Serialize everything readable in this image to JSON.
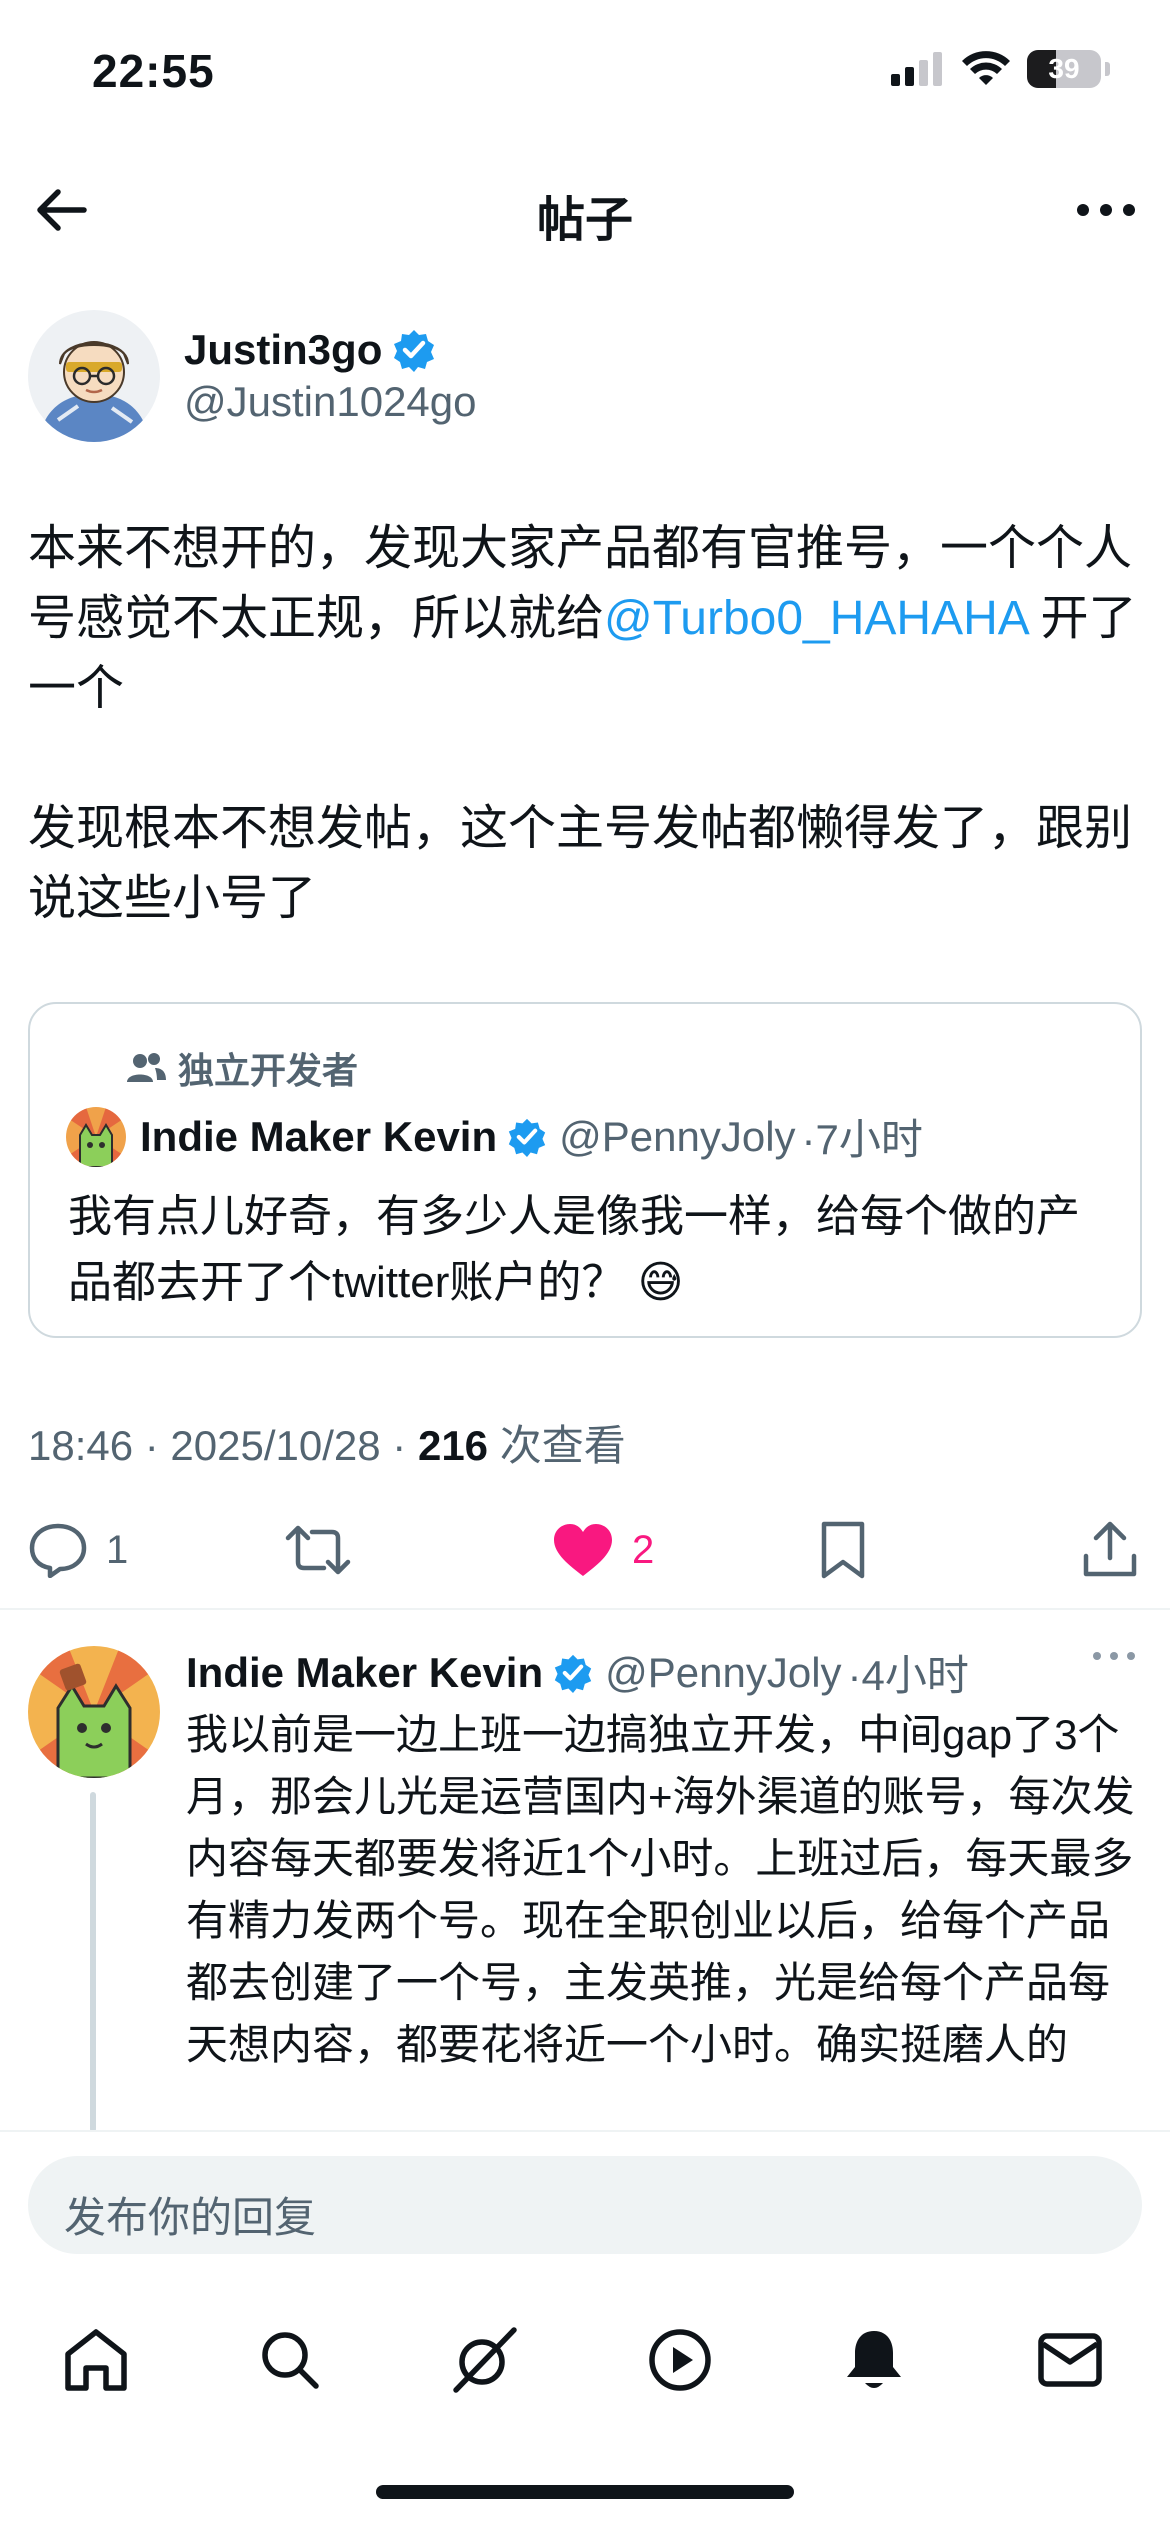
{
  "status_bar": {
    "time": "22:55",
    "battery": "39",
    "battery_level": 0.39
  },
  "nav": {
    "title": "帖子"
  },
  "post": {
    "author": {
      "display_name": "Justin3go",
      "handle": "@Justin1024go",
      "verified": true
    },
    "paragraph1_pre": "本来不想开的，发现大家产品都有官推号，一个个人号感觉不太正规，所以就给",
    "mention": "@Turbo0_HAHAHA",
    "paragraph1_post": " 开了一个",
    "paragraph2": "发现根本不想发帖，这个主号发帖都懒得发了，跟别说这些小号了",
    "timestamp": "18:46 · 2025/10/28 · ",
    "views_count": "216",
    "views_label": " 次查看",
    "stats": {
      "replies": "1",
      "likes": "2"
    }
  },
  "quote": {
    "community": "独立开发者",
    "author": {
      "display_name": "Indie Maker Kevin",
      "handle": "@PennyJoly",
      "time": "·7小时",
      "verified": true
    },
    "text": "我有点儿好奇，有多少人是像我一样，给每个做的产品都去开了个twitter账户的？ 😅"
  },
  "reply": {
    "author": {
      "display_name": "Indie Maker Kevin",
      "handle": "@PennyJoly",
      "time": "·4小时",
      "verified": true
    },
    "text": "我以前是一边上班一边搞独立开发，中间gap了3个月，那会儿光是运营国内+海外渠道的账号，每次发内容每天都要发将近1个小时。上班过后，每天最多有精力发两个号。现在全职创业以后，给每个产品都去创建了一个号，主发英推，光是给每个产品每天想内容，都要花将近一个小时。确实挺磨人的"
  },
  "composer": {
    "placeholder": "发布你的回复"
  },
  "tabbar": {
    "items": [
      "home-icon",
      "search-icon",
      "grok-icon",
      "video-icon",
      "notifications-icon",
      "messages-icon"
    ]
  },
  "colors": {
    "accent": "#1d9bf0",
    "like": "#f91880",
    "text": "#0f1419",
    "secondary": "#536471"
  }
}
